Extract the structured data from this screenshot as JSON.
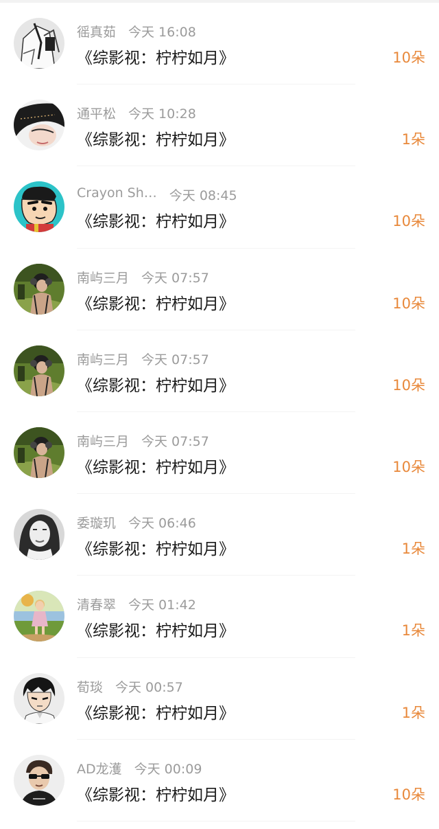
{
  "gift_records": [
    {
      "name": "徭真茹",
      "time": "今天 16:08",
      "title": "《综影视：柠柠如月》",
      "count": "10朵",
      "avatar": "manga-portrait"
    },
    {
      "name": "通平松",
      "time": "今天 10:28",
      "title": "《综影视：柠柠如月》",
      "count": "1朵",
      "avatar": "girl-long-hair"
    },
    {
      "name": "Crayon Sh…",
      "time": "今天 08:45",
      "title": "《综影视：柠柠如月》",
      "count": "10朵",
      "avatar": "cartoon-boy"
    },
    {
      "name": "南屿三月",
      "time": "今天 07:57",
      "title": "《综影视：柠柠如月》",
      "count": "10朵",
      "avatar": "girl-headphones"
    },
    {
      "name": "南屿三月",
      "time": "今天 07:57",
      "title": "《综影视：柠柠如月》",
      "count": "10朵",
      "avatar": "girl-headphones"
    },
    {
      "name": "南屿三月",
      "time": "今天 07:57",
      "title": "《综影视：柠柠如月》",
      "count": "10朵",
      "avatar": "girl-headphones"
    },
    {
      "name": "委璇玑",
      "time": "今天 06:46",
      "title": "《综影视：柠柠如月》",
      "count": "1朵",
      "avatar": "woman-portrait-bw"
    },
    {
      "name": "清春翠",
      "time": "今天 01:42",
      "title": "《综影视：柠柠如月》",
      "count": "1朵",
      "avatar": "child-outdoor"
    },
    {
      "name": "荀琰",
      "time": "今天 00:57",
      "title": "《综影视：柠柠如月》",
      "count": "1朵",
      "avatar": "anime-man"
    },
    {
      "name": "AD龙濩",
      "time": "今天 00:09",
      "title": "《综影视：柠柠如月》",
      "count": "10朵",
      "avatar": "man-sunglasses"
    }
  ],
  "colors": {
    "name_time": "#9b9b9b",
    "title": "#1a1a1a",
    "count": "#e8883a",
    "divider": "#f3f3f3"
  }
}
